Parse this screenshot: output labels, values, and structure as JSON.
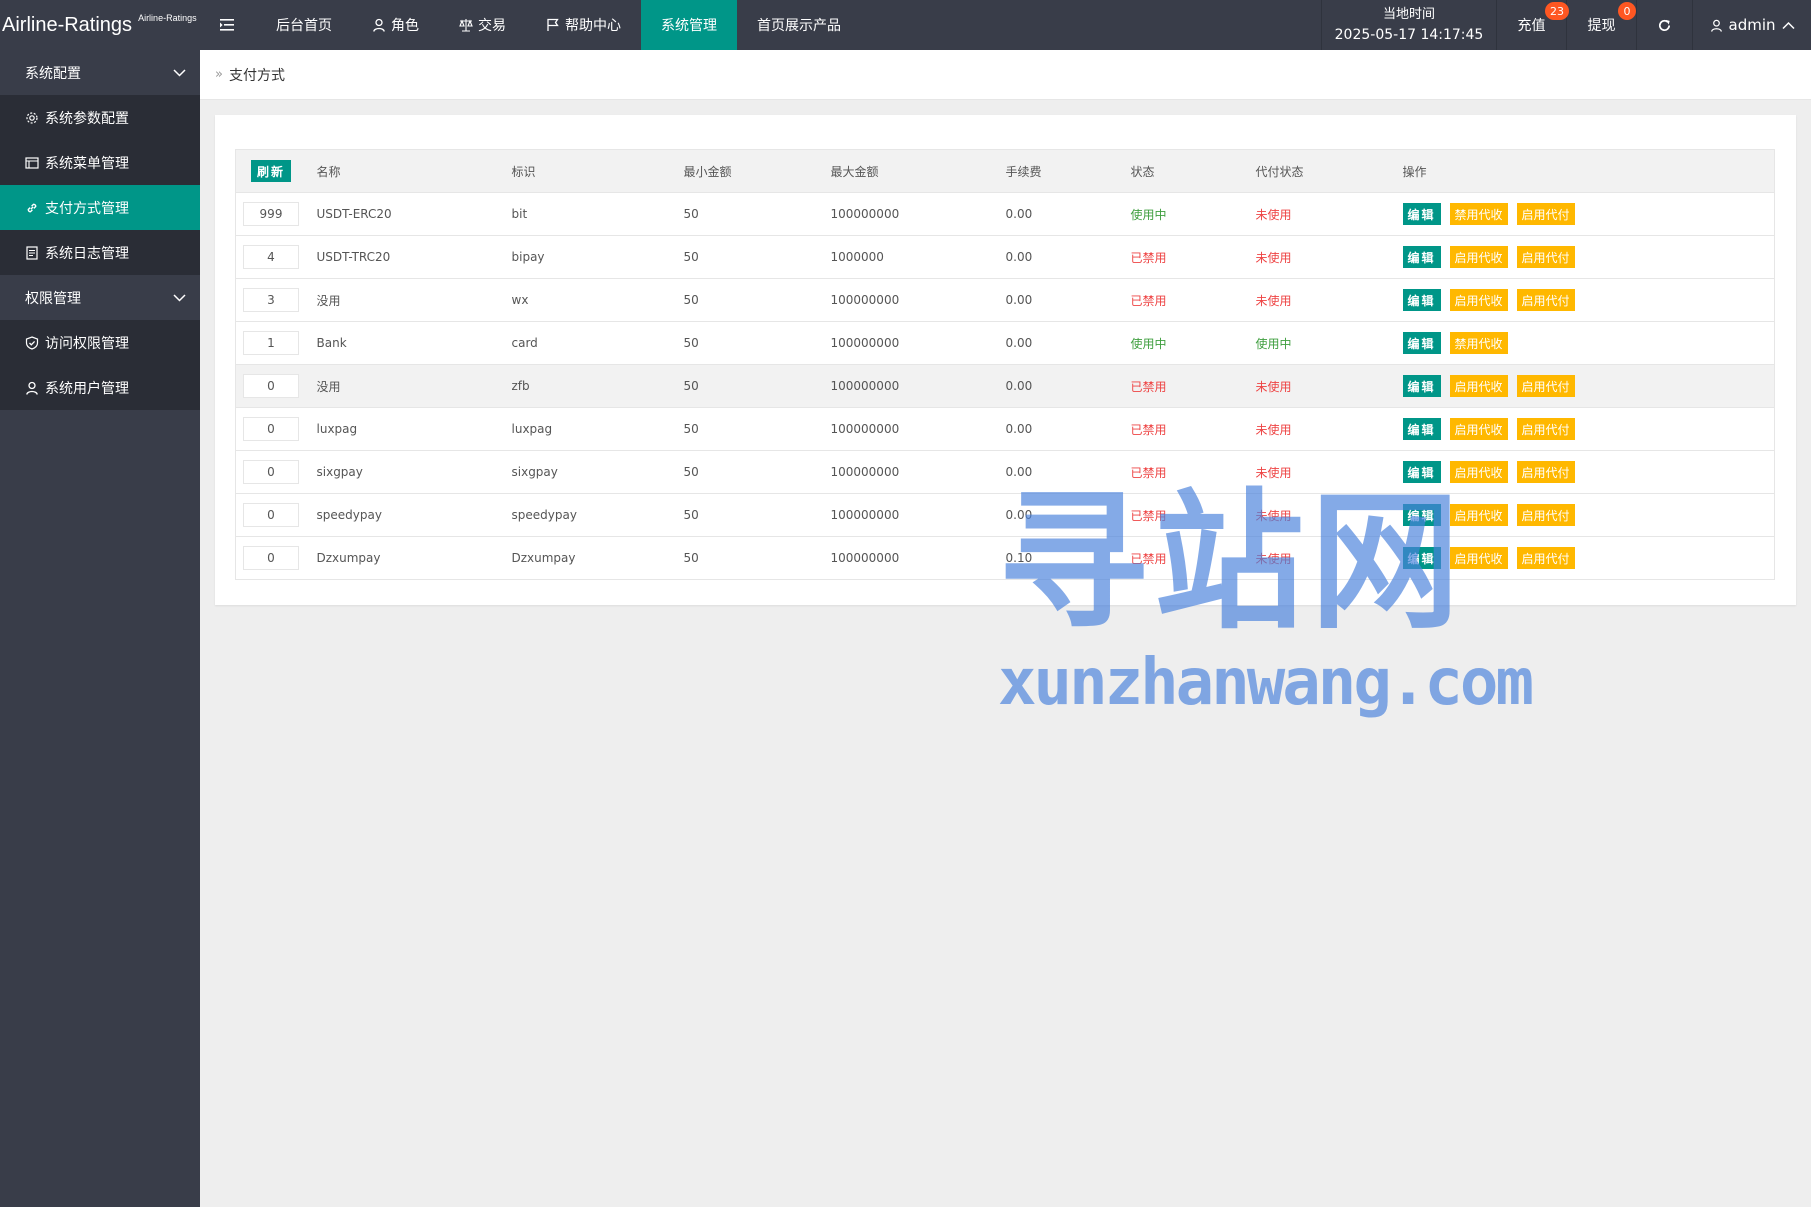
{
  "header": {
    "brand": "Airline-Ratings",
    "brand_sub": "Airline-Ratings",
    "nav": [
      {
        "label": "后台首页",
        "icon": ""
      },
      {
        "label": "角色",
        "icon": "user-icon"
      },
      {
        "label": "交易",
        "icon": "scale-icon"
      },
      {
        "label": "帮助中心",
        "icon": "flag-icon"
      },
      {
        "label": "系统管理",
        "icon": "",
        "active": true
      },
      {
        "label": "首页展示产品",
        "icon": ""
      }
    ],
    "time_label": "当地时间",
    "time_value": "2025-05-17 14:17:45",
    "recharge_label": "充值",
    "recharge_badge": "23",
    "withdraw_label": "提现",
    "withdraw_badge": "0",
    "user_name": "admin"
  },
  "sidebar": {
    "groups": [
      {
        "label": "系统配置",
        "items": [
          {
            "label": "系统参数配置",
            "icon": "gear-icon"
          },
          {
            "label": "系统菜单管理",
            "icon": "menu-icon"
          },
          {
            "label": "支付方式管理",
            "icon": "link-icon",
            "active": true
          },
          {
            "label": "系统日志管理",
            "icon": "log-icon"
          }
        ]
      },
      {
        "label": "权限管理",
        "items": [
          {
            "label": "访问权限管理",
            "icon": "shield-check-icon"
          },
          {
            "label": "系统用户管理",
            "icon": "user-icon"
          }
        ]
      }
    ]
  },
  "breadcrumb": {
    "current": "支付方式"
  },
  "table": {
    "refresh_label": "刷新",
    "columns": [
      "名称",
      "标识",
      "最小金额",
      "最大金额",
      "手续费",
      "状态",
      "代付状态",
      "操作"
    ],
    "rows": [
      {
        "sort": "999",
        "name": "USDT-ERC20",
        "code": "bit",
        "min": "50",
        "max": "100000000",
        "fee": "0.00",
        "status": "使用中",
        "payout": "未使用",
        "actions": [
          "编辑",
          "禁用代收",
          "启用代付"
        ]
      },
      {
        "sort": "4",
        "name": "USDT-TRC20",
        "code": "bipay",
        "min": "50",
        "max": "1000000",
        "fee": "0.00",
        "status": "已禁用",
        "payout": "未使用",
        "actions": [
          "编辑",
          "启用代收",
          "启用代付"
        ]
      },
      {
        "sort": "3",
        "name": "没用",
        "code": "wx",
        "min": "50",
        "max": "100000000",
        "fee": "0.00",
        "status": "已禁用",
        "payout": "未使用",
        "actions": [
          "编辑",
          "启用代收",
          "启用代付"
        ]
      },
      {
        "sort": "1",
        "name": "Bank",
        "code": "card",
        "min": "50",
        "max": "100000000",
        "fee": "0.00",
        "status": "使用中",
        "payout": "使用中",
        "actions": [
          "编辑",
          "禁用代收"
        ]
      },
      {
        "sort": "0",
        "name": "没用",
        "code": "zfb",
        "min": "50",
        "max": "100000000",
        "fee": "0.00",
        "status": "已禁用",
        "payout": "未使用",
        "actions": [
          "编辑",
          "启用代收",
          "启用代付"
        ]
      },
      {
        "sort": "0",
        "name": "luxpag",
        "code": "luxpag",
        "min": "50",
        "max": "100000000",
        "fee": "0.00",
        "status": "已禁用",
        "payout": "未使用",
        "actions": [
          "编辑",
          "启用代收",
          "启用代付"
        ]
      },
      {
        "sort": "0",
        "name": "sixgpay",
        "code": "sixgpay",
        "min": "50",
        "max": "100000000",
        "fee": "0.00",
        "status": "已禁用",
        "payout": "未使用",
        "actions": [
          "编辑",
          "启用代收",
          "启用代付"
        ]
      },
      {
        "sort": "0",
        "name": "speedypay",
        "code": "speedypay",
        "min": "50",
        "max": "100000000",
        "fee": "0.00",
        "status": "已禁用",
        "payout": "未使用",
        "actions": [
          "编辑",
          "启用代收",
          "启用代付"
        ]
      },
      {
        "sort": "0",
        "name": "Dzxumpay",
        "code": "Dzxumpay",
        "min": "50",
        "max": "100000000",
        "fee": "0.10",
        "status": "已禁用",
        "payout": "未使用",
        "actions": [
          "编辑",
          "启用代收",
          "启用代付"
        ]
      }
    ]
  },
  "watermark": {
    "title": "寻站网",
    "url": "xunzhanwang.com"
  },
  "colors": {
    "accent": "#009688",
    "topbar": "#393d49",
    "warn": "#ffb800",
    "badge": "#ff5722"
  }
}
